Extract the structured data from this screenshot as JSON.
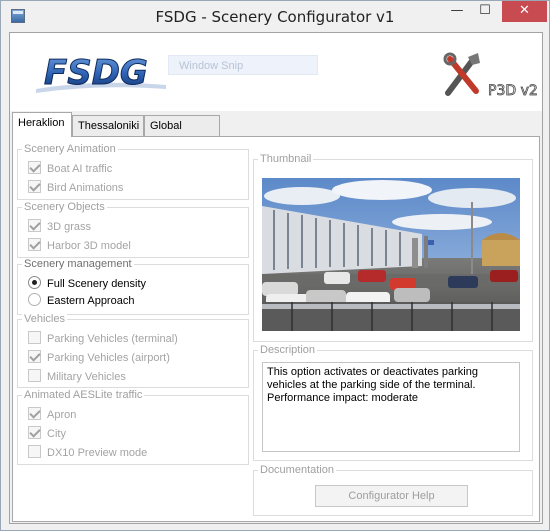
{
  "window": {
    "title": "FSDG - Scenery Configurator v1",
    "controls": {
      "minimize": "—",
      "maximize": "☐",
      "close": "✕"
    }
  },
  "banner": {
    "logo_text": "FSDG",
    "snip_text": "Window Snip",
    "brand_text": "P3D v2"
  },
  "tabs": [
    {
      "label": "Heraklion",
      "active": true
    },
    {
      "label": "Thessaloniki",
      "active": false
    },
    {
      "label": "Global Settings",
      "active": false
    }
  ],
  "groups": {
    "scenery_animation": {
      "title": "Scenery Animation",
      "items": [
        {
          "label": "Boat AI traffic",
          "checked": true,
          "enabled": false
        },
        {
          "label": "Bird Animations",
          "checked": true,
          "enabled": false
        }
      ]
    },
    "scenery_objects": {
      "title": "Scenery Objects",
      "items": [
        {
          "label": "3D grass",
          "checked": true,
          "enabled": false
        },
        {
          "label": "Harbor 3D model",
          "checked": true,
          "enabled": false
        }
      ]
    },
    "scenery_management": {
      "title": "Scenery management",
      "items": [
        {
          "label": "Full Scenery density",
          "selected": true,
          "enabled": true
        },
        {
          "label": "Eastern Approach",
          "selected": false,
          "enabled": true
        }
      ]
    },
    "vehicles": {
      "title": "Vehicles",
      "items": [
        {
          "label": "Parking Vehicles (terminal)",
          "checked": false,
          "enabled": false
        },
        {
          "label": "Parking Vehicles (airport)",
          "checked": true,
          "enabled": false
        },
        {
          "label": "Military Vehicles",
          "checked": false,
          "enabled": false
        }
      ]
    },
    "aes_traffic": {
      "title": "Animated AESLite traffic",
      "items": [
        {
          "label": "Apron",
          "checked": true,
          "enabled": false
        },
        {
          "label": "City",
          "checked": true,
          "enabled": false
        },
        {
          "label": "DX10 Preview mode",
          "checked": false,
          "enabled": false
        }
      ]
    }
  },
  "thumbnail": {
    "title": "Thumbnail"
  },
  "description": {
    "title": "Description",
    "text": "This option activates or deactivates parking vehicles at the parking side of the terminal. Performance impact: moderate"
  },
  "documentation": {
    "title": "Documentation",
    "button_label": "Configurator Help"
  },
  "colors": {
    "close_button": "#c74b50",
    "disabled_text": "#a4a4a4",
    "group_border": "#dcdcdc",
    "logo_blue": "#2b5fb0"
  }
}
